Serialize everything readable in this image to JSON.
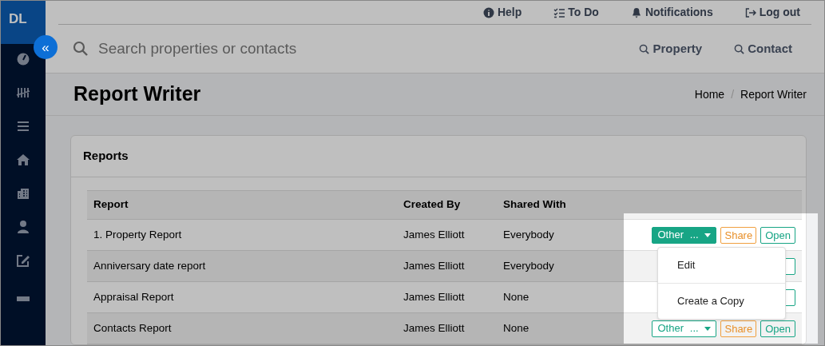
{
  "sidebar": {
    "logo": "DL",
    "collapse_label": "«"
  },
  "top_links": [
    {
      "label": "Help"
    },
    {
      "label": "To Do"
    },
    {
      "label": "Notifications"
    },
    {
      "label": "Log out"
    }
  ],
  "search": {
    "placeholder": "Search properties or contacts",
    "buttons": [
      "Property",
      "Contact"
    ]
  },
  "page_title": "Report Writer",
  "breadcrumb": {
    "items": [
      "Home",
      "Report Writer"
    ],
    "separator": "/"
  },
  "card": {
    "title": "Reports",
    "table": {
      "columns": [
        "Report",
        "Created By",
        "Shared With"
      ],
      "rows": [
        {
          "report": "1. Property Report",
          "created_by": "James Elliott",
          "shared_with": "Everybody",
          "actions": {
            "kind": "full",
            "other": "Other",
            "dots": "...",
            "expanded": true,
            "share": "Share",
            "open": "Open"
          }
        },
        {
          "report": "Anniversary date report",
          "created_by": "James Elliott",
          "shared_with": "Everybody",
          "actions": {
            "kind": "covered"
          }
        },
        {
          "report": "Appraisal Report",
          "created_by": "James Elliott",
          "shared_with": "None",
          "actions": {
            "kind": "covered"
          }
        },
        {
          "report": "Contacts Report",
          "created_by": "James Elliott",
          "shared_with": "None",
          "actions": {
            "kind": "full",
            "other": "Other",
            "dots": "...",
            "expanded": false,
            "share": "Share",
            "open": "Open"
          }
        }
      ]
    }
  },
  "menu": {
    "items": [
      "Edit",
      "Create a Copy"
    ]
  }
}
